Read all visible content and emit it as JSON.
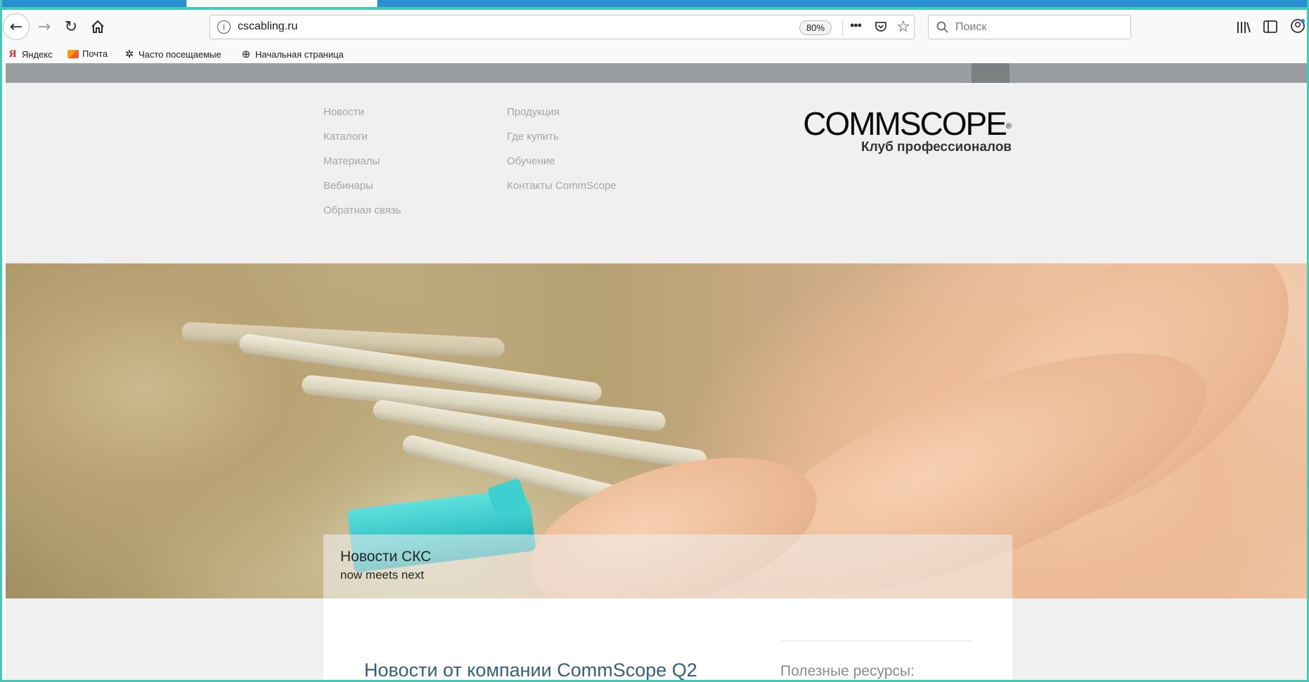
{
  "browser": {
    "url": "cscabling.ru",
    "zoom": "80%",
    "search_placeholder": "Поиск",
    "bookmarks": [
      {
        "label": "Яндекс",
        "icon": "yandex-icon"
      },
      {
        "label": "Почта",
        "icon": "mail-icon"
      },
      {
        "label": "Часто посещаемые",
        "icon": "gear-icon"
      },
      {
        "label": "Начальная страница",
        "icon": "globe-icon"
      }
    ]
  },
  "site": {
    "nav_col1": [
      "Новости",
      "Каталоги",
      "Материалы",
      "Вебинары",
      "Обратная связь"
    ],
    "nav_col2": [
      "Продукция",
      "Где купить",
      "Обучение",
      "Контакты CommScope"
    ],
    "logo": {
      "wordmark": "COMMSCOPE",
      "registered": "®",
      "subtitle": "Клуб профессионалов"
    },
    "hero": {
      "title": "Новости СКС",
      "subtitle": "now meets next"
    },
    "content": {
      "news_heading": "Новости от компании CommScope Q2",
      "sidebar_heading": "Полезные ресурсы:"
    }
  },
  "colors": {
    "frame": "#44c9b6",
    "nav_link": "#a5a5a5",
    "heading": "#35607a",
    "gray_bar": "#9a9d9e"
  }
}
